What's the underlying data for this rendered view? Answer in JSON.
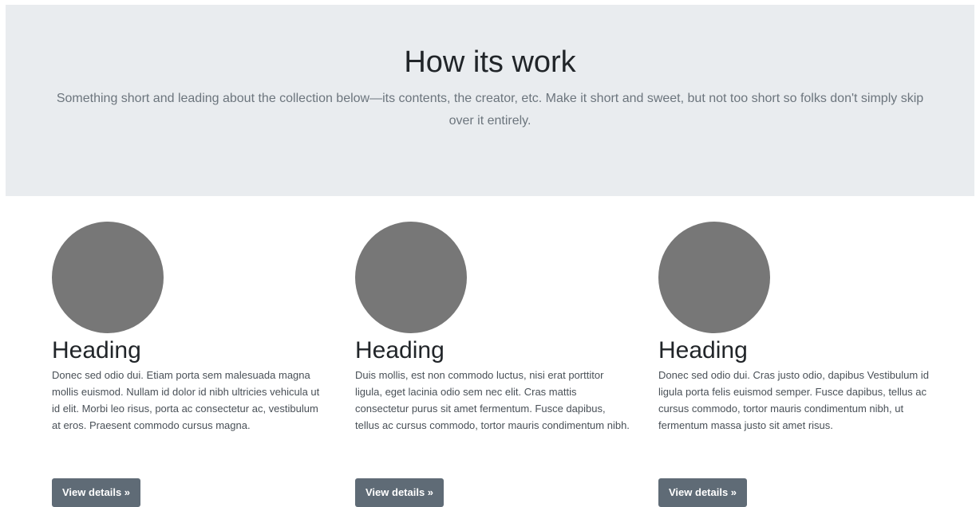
{
  "hero": {
    "title": "How its work",
    "lead": "Something short and leading about the collection below—its contents, the creator, etc. Make it short and sweet, but not too short so folks don't simply skip over it entirely."
  },
  "features": [
    {
      "heading": "Heading",
      "text": "Donec sed odio dui. Etiam porta sem malesuada magna mollis euismod. Nullam id dolor id nibh ultricies vehicula ut id elit. Morbi leo risus, porta ac consectetur ac, vestibulum at eros. Praesent commodo cursus magna.",
      "button_label": "View details »"
    },
    {
      "heading": "Heading",
      "text": "Duis mollis, est non commodo luctus, nisi erat porttitor ligula, eget lacinia odio sem nec elit. Cras mattis consectetur purus sit amet fermentum. Fusce dapibus, tellus ac cursus commodo, tortor mauris condimentum nibh.",
      "button_label": "View details »"
    },
    {
      "heading": "Heading",
      "text": "Donec sed odio dui. Cras justo odio, dapibus Vestibulum id ligula porta felis euismod semper. Fusce dapibus, tellus ac cursus commodo, tortor mauris condimentum nibh, ut fermentum massa justo sit amet risus.",
      "button_label": "View details »"
    }
  ],
  "colors": {
    "hero_background": "#e9ecef",
    "thumbnail": "#777777",
    "button": "#5f6b76"
  }
}
